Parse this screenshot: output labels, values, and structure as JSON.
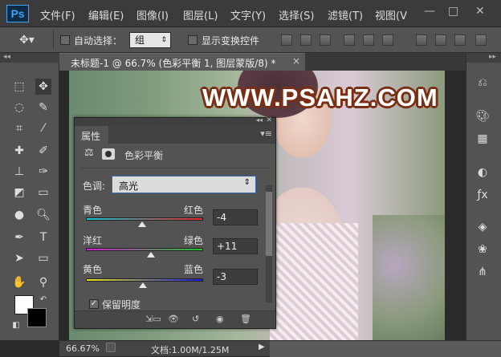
{
  "app": {
    "logo": "Ps",
    "menus": [
      "文件(F)",
      "编辑(E)",
      "图像(I)",
      "图层(L)",
      "文字(Y)",
      "选择(S)",
      "滤镜(T)",
      "视图(V"
    ],
    "window_controls": {
      "minimize": "—",
      "maximize": "□",
      "close": "✕"
    }
  },
  "options": {
    "auto_select_label": "自动选择：",
    "auto_select_value": "组",
    "show_transform_label": "显示变换控件"
  },
  "document": {
    "tab_title": "未标题-1 @ 66.7% (色彩平衡 1, 图层蒙版/8) *",
    "close": "×"
  },
  "canvas": {
    "watermark": "WWW.PSAHZ.COM"
  },
  "properties": {
    "title": "属性",
    "adjustment_name": "色彩平衡",
    "tone_label": "色调:",
    "tone_value": "高光",
    "sliders": [
      {
        "left": "青色",
        "right": "红色",
        "value": "-4",
        "level": -4
      },
      {
        "left": "洋红",
        "right": "绿色",
        "value": "+11",
        "level": 11
      },
      {
        "left": "黄色",
        "right": "蓝色",
        "value": "-3",
        "level": -3
      }
    ],
    "preserve_luminosity": "保留明度"
  },
  "status": {
    "zoom": "66.67%",
    "doc_info": "文档:1.00M/1.25M"
  },
  "colors": {
    "accent": "#3fa3f0",
    "panel": "#535353"
  }
}
